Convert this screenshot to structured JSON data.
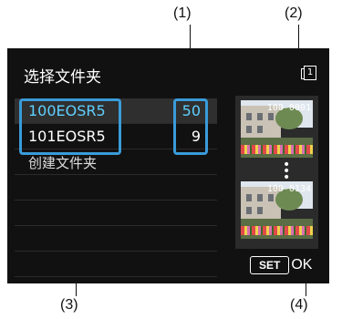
{
  "callouts": {
    "c1": "(1)",
    "c2": "(2)",
    "c3": "(3)",
    "c4": "(4)"
  },
  "screen": {
    "title": "选择文件夹",
    "card_label": "1",
    "folders": [
      {
        "name": "100EOSR5",
        "count": "50"
      },
      {
        "name": "101EOSR5",
        "count": "9"
      }
    ],
    "create_label": "创建文件夹",
    "thumb_first": "100-0001",
    "thumb_last": "100-0134",
    "set_label": "SET",
    "ok_label": "OK"
  },
  "colors": {
    "highlight": "#3a9bd9",
    "selected_text": "#5fd0ff",
    "screen_bg": "#111111"
  }
}
